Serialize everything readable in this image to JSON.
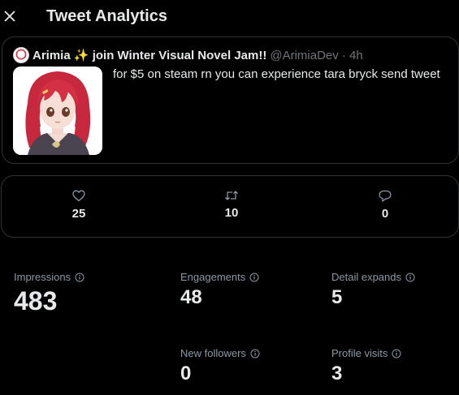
{
  "header": {
    "title": "Tweet Analytics",
    "close_icon": "close-icon"
  },
  "tweet": {
    "display_name": "Arimia ✨ join Winter Visual Novel Jam!!",
    "handle": "@ArimiaDev · 4h",
    "text": "for $5 on steam rn you can experience tara bryck send tweet"
  },
  "engagement": {
    "likes": "25",
    "retweets": "10",
    "replies": "0"
  },
  "metrics": {
    "impressions": {
      "label": "Impressions",
      "value": "483"
    },
    "engagements": {
      "label": "Engagements",
      "value": "48"
    },
    "detail_expands": {
      "label": "Detail expands",
      "value": "5"
    },
    "new_followers": {
      "label": "New followers",
      "value": "0"
    },
    "profile_visits": {
      "label": "Profile visits",
      "value": "3"
    }
  },
  "colors": {
    "background": "#000000",
    "text": "#e7e9ea",
    "muted": "#8b98a5",
    "border": "#2f3336"
  }
}
